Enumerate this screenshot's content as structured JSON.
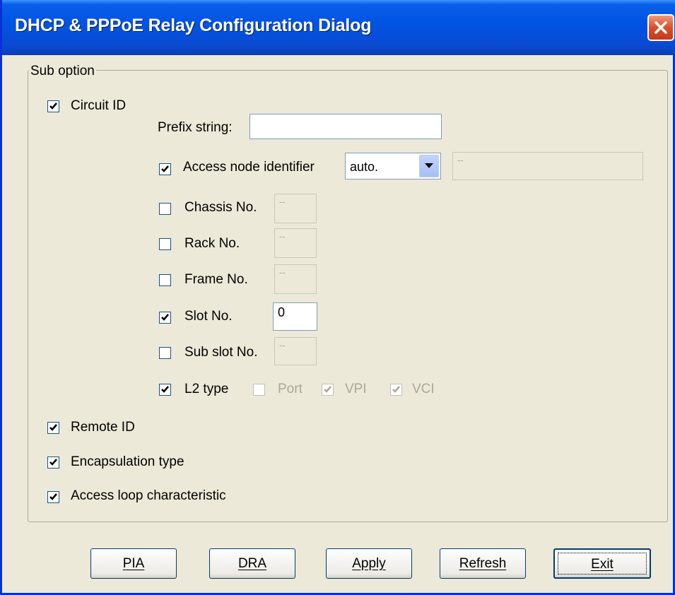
{
  "window": {
    "title": "DHCP & PPPoE Relay Configuration Dialog"
  },
  "group": {
    "legend": "Sub option"
  },
  "circuit_id": {
    "label": "Circuit ID",
    "checked": true
  },
  "prefix": {
    "label": "Prefix string:",
    "value": ""
  },
  "access_node": {
    "label": "Access node identifier",
    "checked": true,
    "select_value": "auto.",
    "text_value": "--"
  },
  "chassis": {
    "label": "Chassis No.",
    "checked": false,
    "value": "--"
  },
  "rack": {
    "label": "Rack No.",
    "checked": false,
    "value": "--"
  },
  "frame": {
    "label": "Frame No.",
    "checked": false,
    "value": "--"
  },
  "slot": {
    "label": "Slot No.",
    "checked": true,
    "value": "0"
  },
  "subslot": {
    "label": "Sub slot No.",
    "checked": false,
    "value": "--"
  },
  "l2type": {
    "label": "L2 type",
    "checked": true,
    "port": {
      "label": "Port",
      "checked": false
    },
    "vpi": {
      "label": "VPI",
      "checked": true
    },
    "vci": {
      "label": "VCI",
      "checked": true
    }
  },
  "remote_id": {
    "label": "Remote ID",
    "checked": true
  },
  "encap": {
    "label": "Encapsulation type",
    "checked": true
  },
  "access_loop": {
    "label": "Access loop characteristic",
    "checked": true
  },
  "buttons": {
    "pia": "PIA",
    "dra": "DRA",
    "apply": "Apply",
    "refresh": "Refresh",
    "exit": "Exit"
  }
}
